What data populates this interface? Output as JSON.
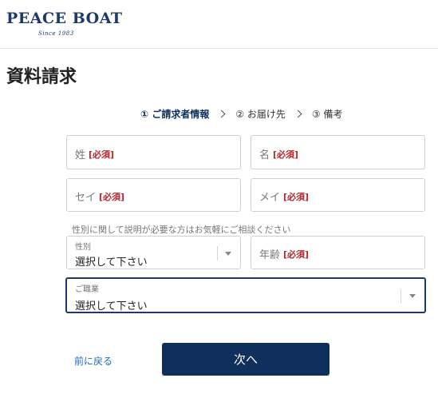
{
  "header": {
    "logo_text": "PEACE BOAT",
    "logo_sub": "Since 1983"
  },
  "page": {
    "title": "資料請求"
  },
  "steps": [
    {
      "label": "① ご請求者情報",
      "active": true
    },
    {
      "label": "② お届け先",
      "active": false
    },
    {
      "label": "③ 備考",
      "active": false
    }
  ],
  "form": {
    "last_name": {
      "placeholder": "姓",
      "required": "[必須]"
    },
    "first_name": {
      "placeholder": "名",
      "required": "[必須]"
    },
    "last_name_kana": {
      "placeholder": "セイ",
      "required": "[必須]"
    },
    "first_name_kana": {
      "placeholder": "メイ",
      "required": "[必須]"
    },
    "gender_helper": "性別に関して説明が必要な方はお気軽にご相談ください",
    "gender": {
      "label": "性別",
      "value": "選択して下さい"
    },
    "age": {
      "placeholder": "年齢",
      "required": "[必須]"
    },
    "occupation": {
      "label": "ご職業",
      "value": "選択して下さい"
    }
  },
  "actions": {
    "back_label": "前に戻る",
    "next_label": "次へ"
  },
  "colors": {
    "brand_navy": "#0f2f5c",
    "required_red": "#b3262b",
    "link_blue": "#1b6fbd"
  }
}
